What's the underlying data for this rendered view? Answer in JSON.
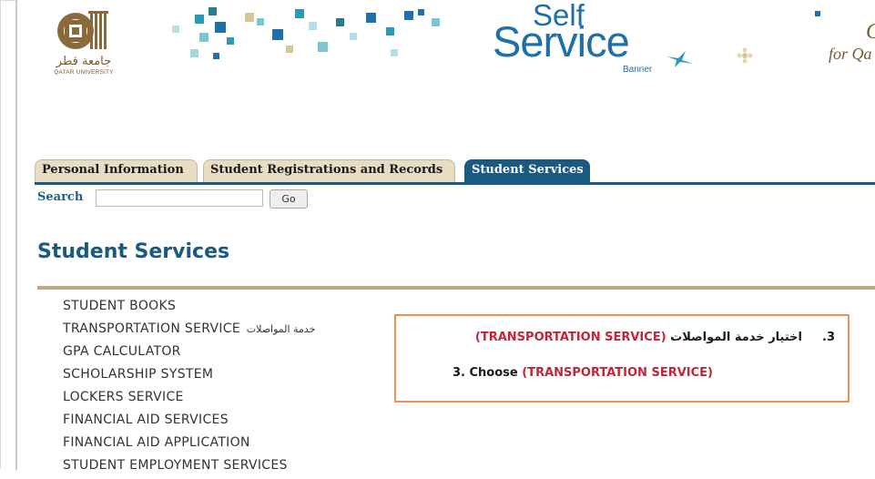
{
  "header": {
    "logo_arabic": "جامعة قطر",
    "logo_english": "QATAR UNIVERSITY",
    "brand_self": "Self",
    "brand_service": "Service",
    "brand_banner": "Banner",
    "tagline_top": "G",
    "tagline_bottom": "for Qa"
  },
  "tabs": [
    {
      "label": "Personal Information",
      "active": false
    },
    {
      "label": "Student Registrations and Records",
      "active": false
    },
    {
      "label": "Student Services",
      "active": true
    }
  ],
  "search": {
    "label": "Search",
    "value": "",
    "button": "Go"
  },
  "page_title": "Student Services",
  "menu": [
    {
      "label": "STUDENT BOOKS",
      "arabic": ""
    },
    {
      "label": "TRANSPORTATION SERVICE",
      "arabic": "خدمة المواصلات"
    },
    {
      "label": "GPA CALCULATOR",
      "arabic": ""
    },
    {
      "label": "SCHOLARSHIP SYSTEM",
      "arabic": ""
    },
    {
      "label": "LOCKERS SERVICE",
      "arabic": ""
    },
    {
      "label": "FINANCIAL AID SERVICES",
      "arabic": ""
    },
    {
      "label": "FINANCIAL AID APPLICATION",
      "arabic": ""
    },
    {
      "label": "STUDENT EMPLOYMENT SERVICES",
      "arabic": ""
    }
  ],
  "callout": {
    "ar_number": "3.",
    "ar_text": "اختيار خدمة المواصلات",
    "ar_highlight": "(TRANSPORTATION SERVICE)",
    "en_text": "3. Choose",
    "en_highlight": "(TRANSPORTATION SERVICE)"
  },
  "colors": {
    "brand_blue": "#1b5a80",
    "tab_beige": "#e8dcc4",
    "rule_tan": "#c4a882",
    "callout_border": "#f0924e",
    "highlight_red": "#c0263a"
  }
}
